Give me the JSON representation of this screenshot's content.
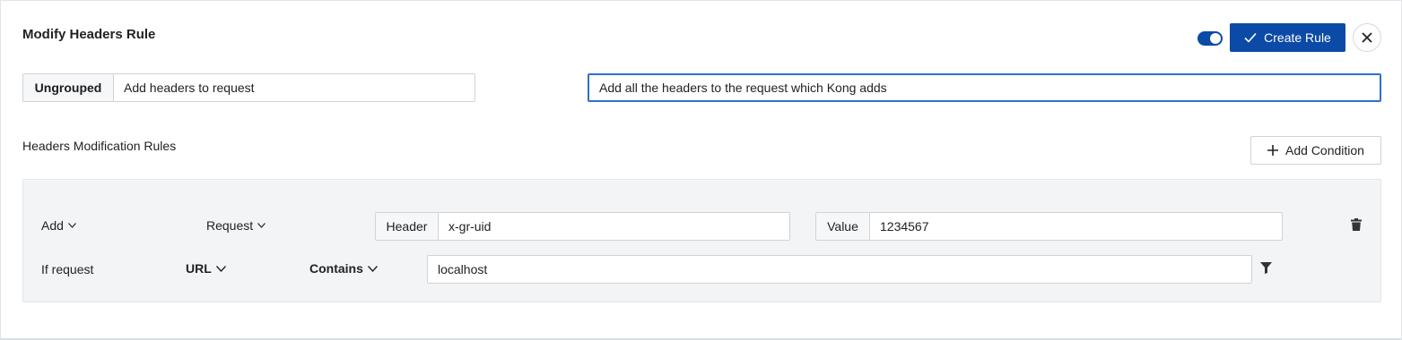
{
  "header": {
    "title": "Modify Headers Rule",
    "toggle_enabled": true,
    "create_label": "Create Rule",
    "accent_color": "#0b4aa6"
  },
  "rule_info": {
    "group_label": "Ungrouped",
    "rule_name": "Add headers to request",
    "description": "Add all the headers to the request which Kong adds"
  },
  "section": {
    "title": "Headers Modification Rules",
    "add_condition_label": "Add Condition"
  },
  "modification": {
    "action": "Add",
    "target": "Request",
    "header_label": "Header",
    "header_value": "x-gr-uid",
    "value_label": "Value",
    "value_value": "1234567"
  },
  "condition": {
    "prefix": "If request",
    "field": "URL",
    "operator": "Contains",
    "value": "localhost"
  },
  "icons": {
    "check": "check-icon",
    "close": "close-icon",
    "plus": "plus-icon",
    "chevron": "chevron-down-icon",
    "delete": "trash-icon",
    "filter": "filter-icon"
  }
}
